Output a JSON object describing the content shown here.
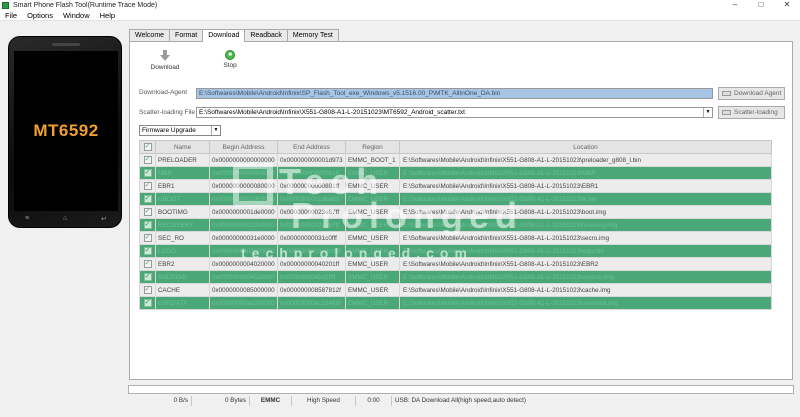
{
  "window": {
    "title": "Smart Phone Flash Tool(Runtime Trace Mode)",
    "minimize": "–",
    "maximize": "□",
    "close": "✕"
  },
  "menu": [
    "File",
    "Options",
    "Window",
    "Help"
  ],
  "phone": {
    "chip_label": "MT6592",
    "key_left": "≡",
    "key_home": "⌂",
    "key_back": "↵"
  },
  "tabs": [
    "Welcome",
    "Format",
    "Download",
    "Readback",
    "Memory Test"
  ],
  "active_tab": "Download",
  "toolbar": {
    "download_label": "Download",
    "stop_label": "Stop"
  },
  "download_agent": {
    "label": "Download-Agent",
    "value": "E:\\Softwares\\Mobile\\Android\\Infinix\\SP_Flash_Tool_exe_Windows_v5.1516.00_P\\MTK_AllInOne_DA.bin",
    "button": "Download Agent"
  },
  "scatter": {
    "label": "Scatter-loading File",
    "value": "E:\\Softwares\\Mobile\\Android\\Infinix\\X551-G808-A1-L-20151023\\MT6592_Android_scatter.txt",
    "button": "Scatter-loading"
  },
  "mode_select": "Firmware Upgrade",
  "table": {
    "headers": [
      "",
      "Name",
      "Begin Address",
      "End Address",
      "Region",
      "Location"
    ],
    "rows": [
      [
        "PRELOADER",
        "0x0000000000000000",
        "0x000000000001d973",
        "EMMC_BOOT_1",
        "E:\\Softwares\\Mobile\\Android\\Infinix\\X551-G808-A1-L-20151023\\preloader_g808_l.bin"
      ],
      [
        "MBR",
        "0x0000000000000000",
        "0x00000000000001ff",
        "EMMC_USER",
        "E:\\Softwares\\Mobile\\Android\\Infinix\\X551-G808-A1-L-20151023\\MBR"
      ],
      [
        "EBR1",
        "0x0000000000080000",
        "0x00000000000801ff",
        "EMMC_USER",
        "E:\\Softwares\\Mobile\\Android\\Infinix\\X551-G808-A1-L-20151023\\EBR1"
      ],
      [
        "UBOOT",
        "0x0000000001d60000",
        "0x0000000001dba697",
        "EMMC_USER",
        "E:\\Softwares\\Mobile\\Android\\Infinix\\X551-G808-A1-L-20151023\\lk.bin"
      ],
      [
        "BOOTIMG",
        "0x0000000001de0000",
        "0x00000000023e87ff",
        "EMMC_USER",
        "E:\\Softwares\\Mobile\\Android\\Infinix\\X551-G808-A1-L-20151023\\boot.img"
      ],
      [
        "RECOVERY",
        "0x00000000023e0000",
        "0x0000000002a0b7ff",
        "EMMC_USER",
        "E:\\Softwares\\Mobile\\Android\\Infinix\\X551-G808-A1-L-20151023\\recovery.img"
      ],
      [
        "SEC_RO",
        "0x00000000031e0000",
        "0x00000000031c0fff",
        "EMMC_USER",
        "E:\\Softwares\\Mobile\\Android\\Infinix\\X551-G808-A1-L-20151023\\secro.img"
      ],
      [
        "LOGO",
        "0x0000000003b00000",
        "0x0000000003c9b35f",
        "EMMC_USER",
        "E:\\Softwares\\Mobile\\Android\\Infinix\\X551-G808-A1-L-20151023\\logo.bin"
      ],
      [
        "EBR2",
        "0x0000000004020000",
        "0x00000000040201ff",
        "EMMC_USER",
        "E:\\Softwares\\Mobile\\Android\\Infinix\\X551-G808-A1-L-20151023\\EBR2"
      ],
      [
        "ANDROID",
        "0x0000000004520000",
        "0x000000004bd3ffff",
        "EMMC_USER",
        "E:\\Softwares\\Mobile\\Android\\Infinix\\X551-G808-A1-L-20151023\\system.img"
      ],
      [
        "CACHE",
        "0x0000000085000000",
        "0x000000008587812f",
        "EMMC_USER",
        "E:\\Softwares\\Mobile\\Android\\Infinix\\X551-G808-A1-L-20151023\\cache.img"
      ],
      [
        "USRDATA",
        "0x00000000ab200000",
        "0x00000000ac2d46bf",
        "EMMC_USER",
        "E:\\Softwares\\Mobile\\Android\\Infinix\\X551-G808-A1-L-20151023\\userdata.img"
      ]
    ]
  },
  "watermark": {
    "line1": "Tech",
    "line2": "Prolonged",
    "line3": "techprolonged.com"
  },
  "status": {
    "speed": "0 B/s",
    "bytes": "0 Bytes",
    "storage": "EMMC",
    "mode": "High Speed",
    "time": "0:00",
    "usb": "USB: DA Download All(high speed,auto detect)"
  },
  "colors": {
    "checked_row": "#4aa878",
    "agent_field": "#a8c4e4",
    "chip_label": "#f0a030"
  }
}
